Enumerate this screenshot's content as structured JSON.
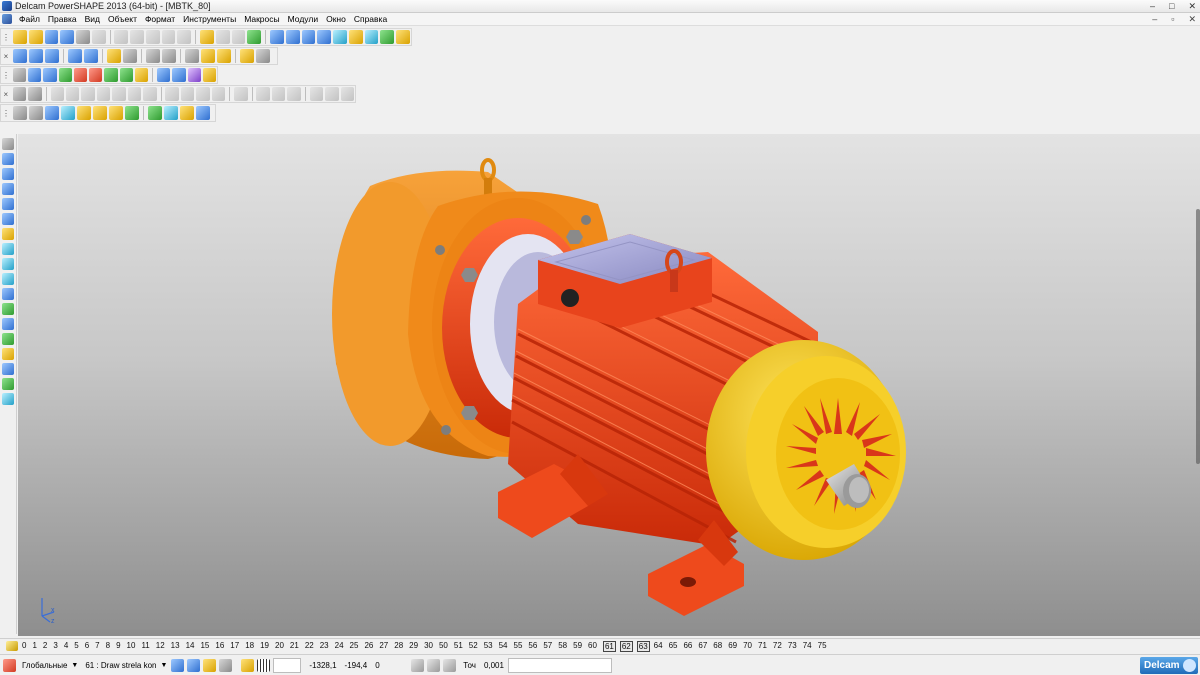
{
  "window": {
    "title": "Delcam PowerSHAPE 2013 (64-bit) - [MBTK_80]",
    "controls": [
      "–",
      "□",
      "✕"
    ]
  },
  "menu": {
    "items": [
      "Файл",
      "Правка",
      "Вид",
      "Объект",
      "Формат",
      "Инструменты",
      "Макросы",
      "Модули",
      "Окно",
      "Справка"
    ],
    "doc_controls": [
      "–",
      "▫",
      "✕"
    ]
  },
  "levels": {
    "numbers": [
      "0",
      "1",
      "2",
      "3",
      "4",
      "5",
      "6",
      "7",
      "8",
      "9",
      "10",
      "11",
      "12",
      "13",
      "14",
      "15",
      "16",
      "17",
      "18",
      "19",
      "20",
      "21",
      "22",
      "23",
      "24",
      "25",
      "26",
      "27",
      "28",
      "29",
      "30",
      "50",
      "51",
      "52",
      "53",
      "54",
      "55",
      "56",
      "57",
      "58",
      "59",
      "60",
      "61",
      "62",
      "63",
      "64",
      "65",
      "66",
      "67",
      "68",
      "69",
      "70",
      "71",
      "72",
      "73",
      "74",
      "75"
    ],
    "selected": [
      "61",
      "62",
      "63"
    ]
  },
  "status": {
    "workplane": "Глобальные",
    "active_level": "61 : Draw strela kon",
    "x": "-1328,1",
    "y": "-194,4",
    "z": "0",
    "tol_label": "Точ",
    "tol_value": "0,001",
    "brand": "Delcam"
  },
  "colors": {
    "body_red": "#e8441c",
    "brake_orange": "#f08a1a",
    "fan_cover_yellow": "#f4c214",
    "terminal_box_lavender": "#a9a9d6"
  },
  "icons": {
    "axis_label_x": "x",
    "axis_label_z": "z"
  }
}
